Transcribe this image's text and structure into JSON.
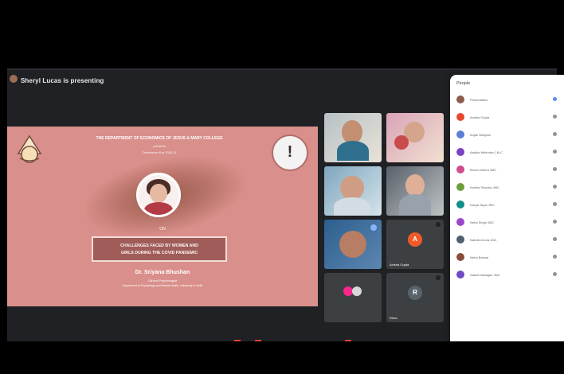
{
  "window": {
    "presenter_label": "Sheryl Lucas is presenting"
  },
  "slide": {
    "title": "THE DEPARTMENT OF ECONOMICS OF JESUS & MARY COLLEGE",
    "subtitle": "presents",
    "event": "Conference Era 2020-21",
    "on": "ON",
    "topic_line1": "CHALLENGES FACED BY WOMEN AND",
    "topic_line2": "GIRLS DURING THE COVID PANDEMIC",
    "speaker_name": "Dr. Sriyana Bhushan",
    "speaker_role": "Clinical Psychologist",
    "speaker_org": "Department of Psychology and Mental Health, University of Delhi"
  },
  "tiles": {
    "tile_5_label": "Anisha Gupta",
    "tile_6_label": "",
    "tile_7_label": "Rhea"
  },
  "people": {
    "title": "People",
    "items": [
      {
        "name": "Presentation"
      },
      {
        "name": "Anisha Gupta"
      },
      {
        "name": "Anjali Vaidyam"
      },
      {
        "name": "Aastha Mehrotra J.M.C"
      },
      {
        "name": "Bhumi Mehra JMC"
      },
      {
        "name": "Kanika Sharma JMC"
      },
      {
        "name": "Kavya Tayal JMC"
      },
      {
        "name": "Neha Singh JMC"
      },
      {
        "name": "Nandini Arora JMC"
      },
      {
        "name": "Neha Bansal"
      },
      {
        "name": "Sakshi Mahajan JMC"
      }
    ]
  }
}
